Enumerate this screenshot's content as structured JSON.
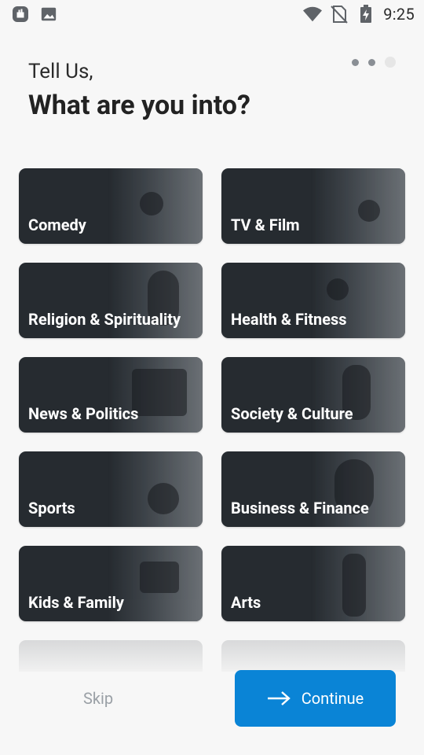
{
  "status_bar": {
    "time": "9:25",
    "left_icons": [
      "notification-app-icon",
      "image-icon"
    ],
    "right_icons": [
      "wifi-icon",
      "no-sim-icon",
      "battery-charging-icon"
    ]
  },
  "header": {
    "greeting": "Tell Us,",
    "title": "What are you into?"
  },
  "pager": {
    "total": 3,
    "active_index": 2
  },
  "categories": [
    {
      "label": "Comedy"
    },
    {
      "label": "TV & Film"
    },
    {
      "label": "Religion & Spirituality"
    },
    {
      "label": "Health & Fitness"
    },
    {
      "label": "News & Politics"
    },
    {
      "label": "Society & Culture"
    },
    {
      "label": "Sports"
    },
    {
      "label": "Business & Finance"
    },
    {
      "label": "Kids & Family"
    },
    {
      "label": "Arts"
    }
  ],
  "actions": {
    "skip_label": "Skip",
    "continue_label": "Continue",
    "continue_color": "#0a84d6"
  }
}
